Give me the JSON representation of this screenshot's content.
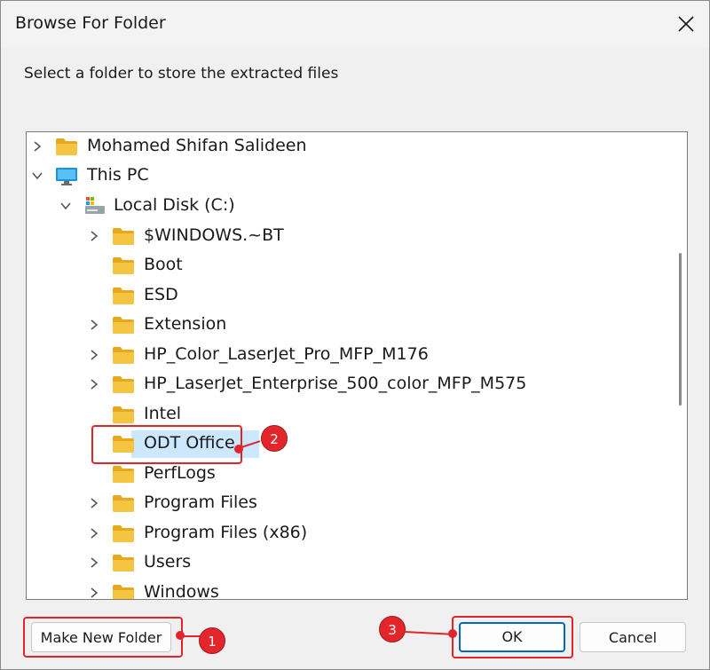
{
  "window": {
    "title": "Browse For Folder",
    "instruction": "Select a folder to store the extracted files"
  },
  "tree": {
    "rows": [
      {
        "label": "Mohamed Shifan Salideen",
        "icon": "user-folder-icon",
        "chevron": "right"
      },
      {
        "label": "This PC",
        "icon": "monitor-icon",
        "chevron": "down"
      },
      {
        "label": "Local Disk (C:)",
        "icon": "drive-icon",
        "chevron": "down"
      },
      {
        "label": "$WINDOWS.~BT",
        "icon": "folder-icon",
        "chevron": "right"
      },
      {
        "label": "Boot",
        "icon": "folder-icon",
        "chevron": "none"
      },
      {
        "label": "ESD",
        "icon": "folder-icon",
        "chevron": "none"
      },
      {
        "label": "Extension",
        "icon": "folder-icon",
        "chevron": "right"
      },
      {
        "label": "HP_Color_LaserJet_Pro_MFP_M176",
        "icon": "folder-icon",
        "chevron": "right"
      },
      {
        "label": "HP_LaserJet_Enterprise_500_color_MFP_M575",
        "icon": "folder-icon",
        "chevron": "right"
      },
      {
        "label": "Intel",
        "icon": "folder-icon",
        "chevron": "none"
      },
      {
        "label": "ODT Office",
        "icon": "folder-icon",
        "chevron": "none",
        "selected": true
      },
      {
        "label": "PerfLogs",
        "icon": "folder-icon",
        "chevron": "none"
      },
      {
        "label": "Program Files",
        "icon": "folder-icon",
        "chevron": "right"
      },
      {
        "label": "Program Files (x86)",
        "icon": "folder-icon",
        "chevron": "right"
      },
      {
        "label": "Users",
        "icon": "folder-icon",
        "chevron": "right"
      },
      {
        "label": "Windows",
        "icon": "folder-icon",
        "chevron": "right"
      }
    ]
  },
  "buttons": {
    "make_new_folder": "Make New Folder",
    "ok": "OK",
    "cancel": "Cancel"
  },
  "callouts": {
    "one": "1",
    "two": "2",
    "three": "3"
  },
  "colors": {
    "folder": "#f5c542",
    "selection": "#cce8ff",
    "annotation": "#e0262b",
    "accent": "#0067c0"
  }
}
